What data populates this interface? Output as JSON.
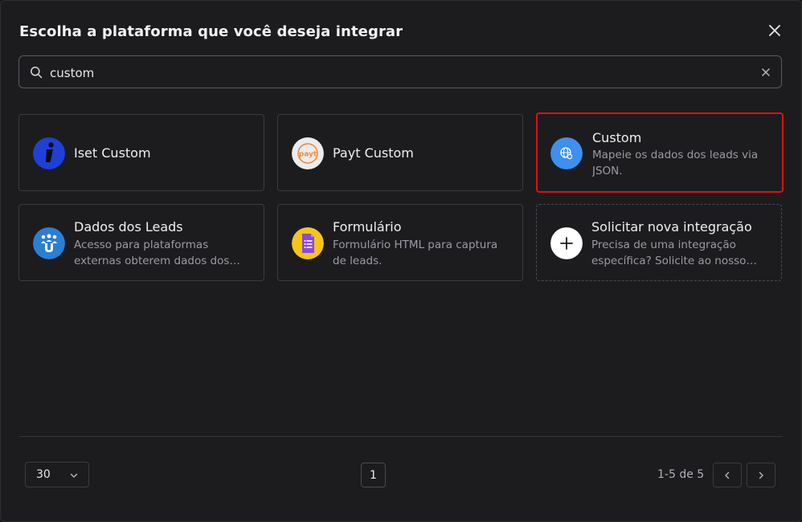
{
  "modal": {
    "title": "Escolha a plataforma que você deseja integrar"
  },
  "search": {
    "value": "custom",
    "placeholder": ""
  },
  "cards": [
    {
      "title": "Iset Custom",
      "description": "",
      "icon": "iset-logo-icon"
    },
    {
      "title": "Payt Custom",
      "description": "",
      "icon": "payt-logo-icon"
    },
    {
      "title": "Custom",
      "description": "Mapeie os dados dos leads via JSON.",
      "icon": "globe-gear-icon"
    },
    {
      "title": "Dados dos Leads",
      "description": "Acesso para plataformas externas obterem dados dos leads.",
      "icon": "users-icon"
    },
    {
      "title": "Formulário",
      "description": "Formulário HTML para captura de leads.",
      "icon": "form-icon"
    },
    {
      "title": "Solicitar nova integração",
      "description": "Precisa de uma integração específica? Solicite ao nosso time.",
      "icon": "plus-icon"
    }
  ],
  "pagination": {
    "page_size": "30",
    "current_page": "1",
    "range": "1-5 de 5"
  },
  "colors": {
    "selected_border": "#e01010",
    "iset_blue": "#1f3fd6",
    "custom_blue": "#3d8ff0",
    "users_blue": "#2a7fd4",
    "form_yellow": "#f5c518",
    "form_purple": "#8a4ad8"
  }
}
